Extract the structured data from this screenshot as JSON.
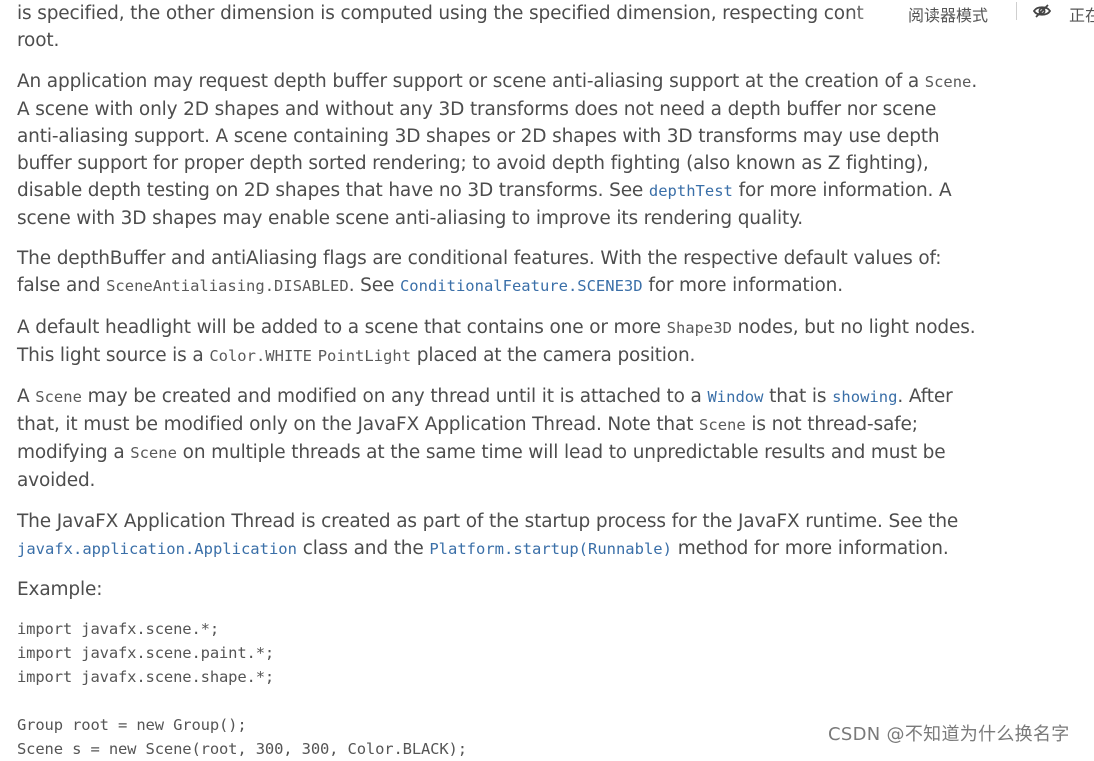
{
  "reader_bar": {
    "label": "阅读器模式",
    "eye_icon": "eye-slash-icon",
    "more": "正在"
  },
  "paragraphs": {
    "p0_line1": "is specified, the other dimension is computed using the specified dimension, respecting cont",
    "p0_line2": "root.",
    "p1_a": "An application may request depth buffer support or scene anti-aliasing support at the creation of a ",
    "p1_code1": "Scene",
    "p1_b": ". A scene with only 2D shapes and without any 3D transforms does not need a depth buffer nor scene anti-aliasing support. A scene containing 3D shapes or 2D shapes with 3D transforms may use depth buffer support for proper depth sorted rendering; to avoid depth fighting (also known as Z fighting), disable depth testing on 2D shapes that have no 3D transforms. See ",
    "p1_link1": "depthTest",
    "p1_c": " for more information. A scene with 3D shapes may enable scene anti-aliasing to improve its rendering quality.",
    "p2_a": "The depthBuffer and antiAliasing flags are conditional features. With the respective default values of: false and ",
    "p2_code1": "SceneAntialiasing.DISABLED",
    "p2_b": ". See ",
    "p2_link1": "ConditionalFeature.SCENE3D",
    "p2_c": " for more information.",
    "p3_a": "A default headlight will be added to a scene that contains one or more ",
    "p3_code1": "Shape3D",
    "p3_b": " nodes, but no light nodes. This light source is a ",
    "p3_code2": "Color.WHITE",
    "p3_code3": "PointLight",
    "p3_c": " placed at the camera position.",
    "p4_a": "A ",
    "p4_code1": "Scene",
    "p4_b": " may be created and modified on any thread until it is attached to a ",
    "p4_link1": "Window",
    "p4_c": " that is ",
    "p4_link2": "showing",
    "p4_d": ". After that, it must be modified only on the JavaFX Application Thread. Note that ",
    "p4_code2": "Scene",
    "p4_e": " is not thread-safe; modifying a ",
    "p4_code3": "Scene",
    "p4_f": " on multiple threads at the same time will lead to unpredictable results and must be avoided.",
    "p5_a": "The JavaFX Application Thread is created as part of the startup process for the JavaFX runtime. See the ",
    "p5_link1": "javafx.application.Application",
    "p5_b": " class and the ",
    "p5_link2": "Platform.startup(Runnable)",
    "p5_c": " method for more information.",
    "example_label": "Example:"
  },
  "code_lines": {
    "l1": "import javafx.scene.*;",
    "l2": "import javafx.scene.paint.*;",
    "l3": "import javafx.scene.shape.*;",
    "l4": "",
    "l5": "Group root = new Group();",
    "l6": "Scene s = new Scene(root, 300, 300, Color.BLACK);"
  },
  "watermark": "CSDN @不知道为什么换名字",
  "colors": {
    "text": "#4d4d4d",
    "link": "#3a6fa8",
    "code": "#555555"
  }
}
